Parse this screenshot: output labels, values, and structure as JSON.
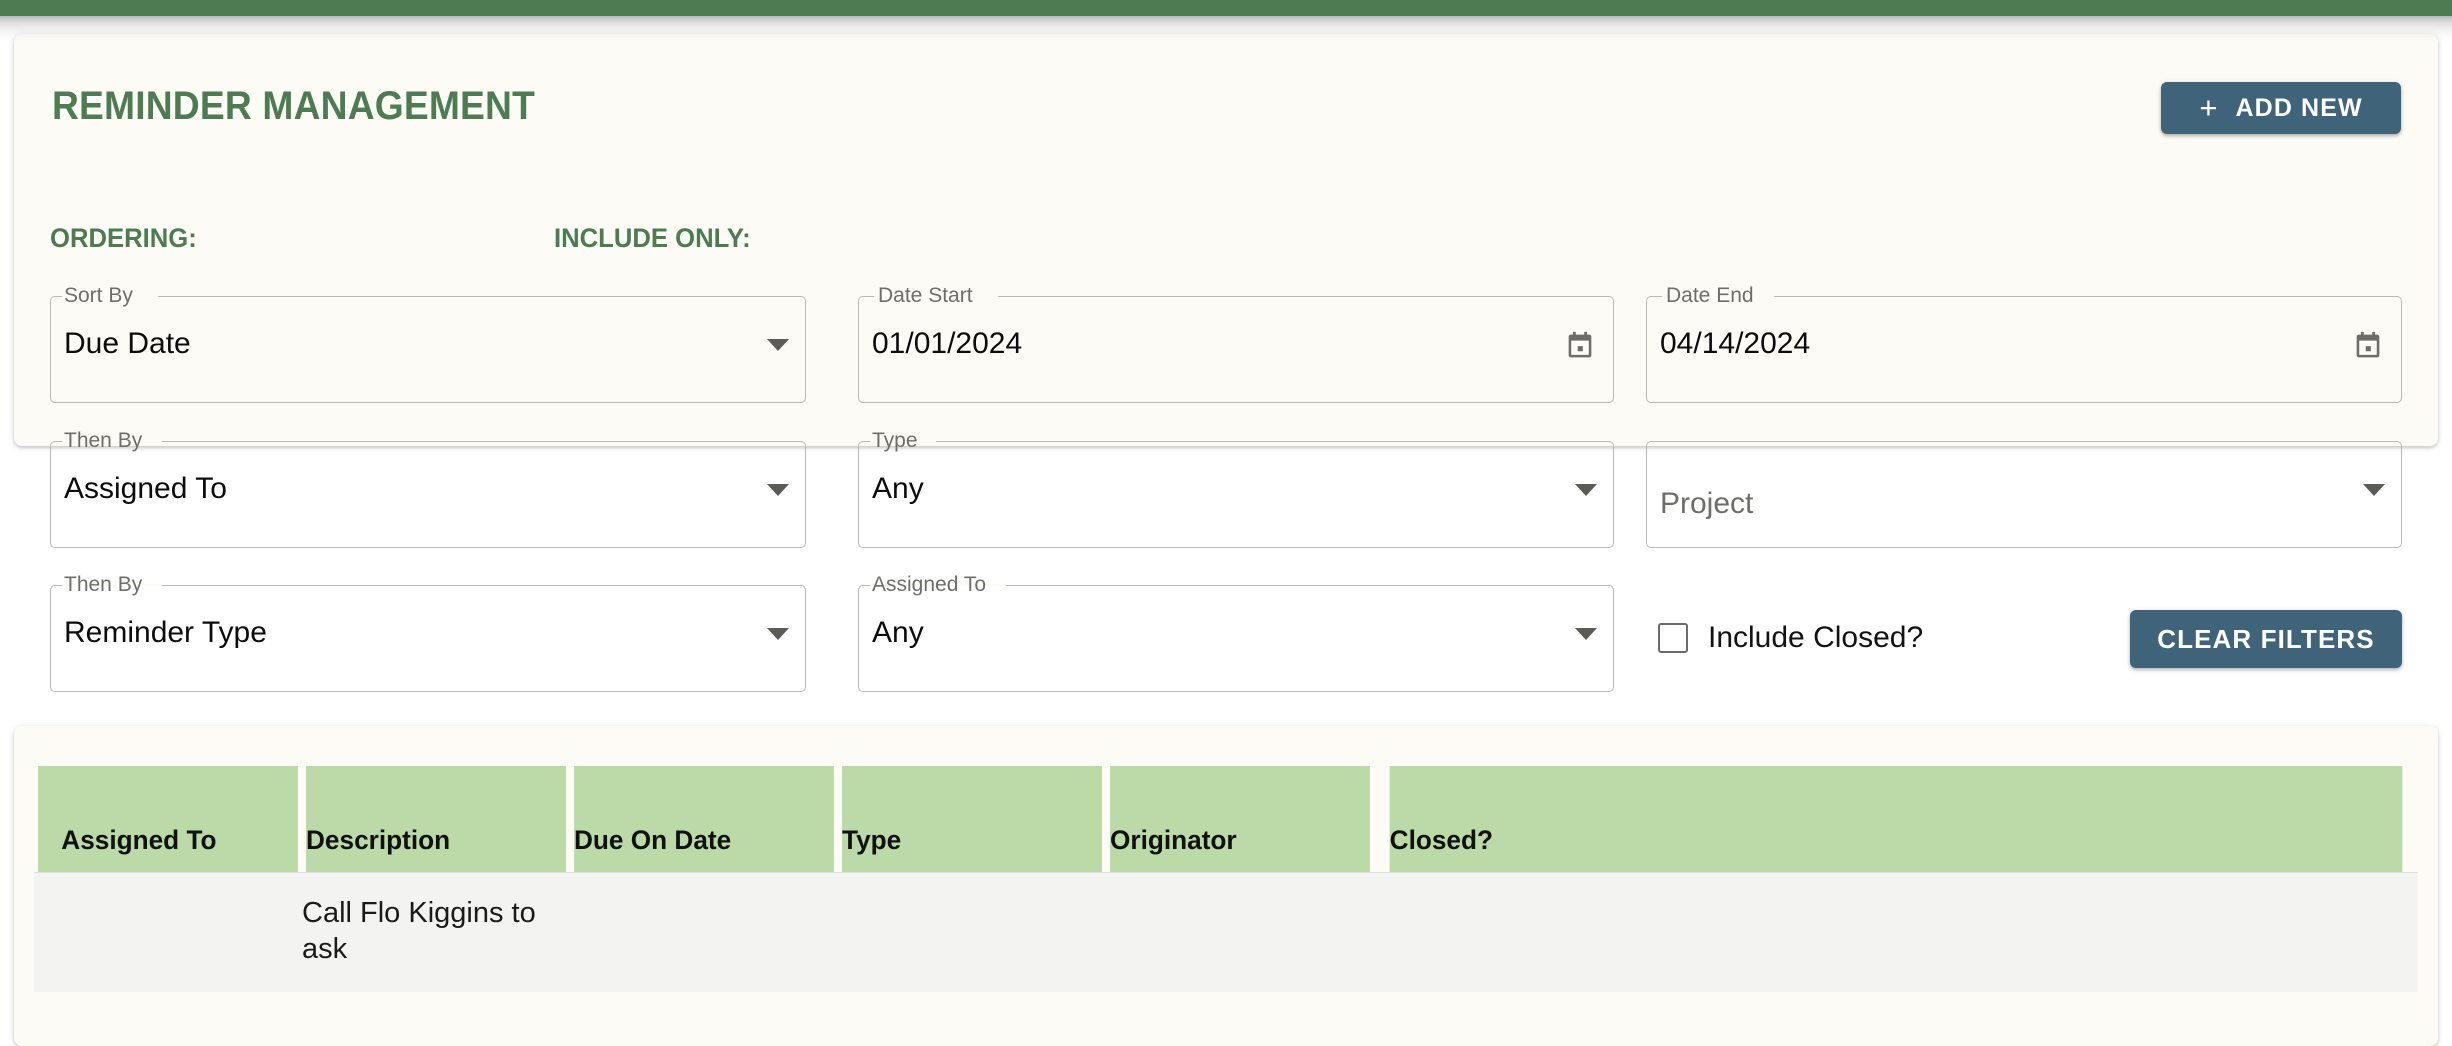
{
  "app_bar": {
    "color": "#4d7b52"
  },
  "theme": {
    "accent_green": "#4d7b52",
    "card_bg": "#fcfbf5",
    "button_blue": "#3f6378",
    "table_header_green": "#bcd9a8",
    "table_row_bg": "#f3f3f2"
  },
  "header": {
    "title": "REMINDER MANAGEMENT",
    "add_new_label": "ADD NEW",
    "add_new_icon": "plus-icon"
  },
  "filters": {
    "ordering_label": "ORDERING:",
    "include_only_label": "INCLUDE ONLY:",
    "sort_by": {
      "label": "Sort By",
      "value": "Due Date",
      "icon": "chevron-down-icon"
    },
    "then_by_1": {
      "label": "Then By",
      "value": "Assigned To",
      "icon": "chevron-down-icon"
    },
    "then_by_2": {
      "label": "Then By",
      "value": "Reminder Type",
      "icon": "chevron-down-icon"
    },
    "date_start": {
      "label": "Date Start",
      "value": "01/01/2024",
      "icon": "calendar-icon"
    },
    "date_end": {
      "label": "Date End",
      "value": "04/14/2024",
      "icon": "calendar-icon"
    },
    "type": {
      "label": "Type",
      "value": "Any",
      "icon": "chevron-down-icon"
    },
    "assigned_to": {
      "label": "Assigned To",
      "value": "Any",
      "icon": "chevron-down-icon"
    },
    "project": {
      "label": "",
      "placeholder": "Project",
      "icon": "chevron-down-icon"
    },
    "include_closed": {
      "label": "Include Closed?",
      "checked": false
    },
    "clear_filters_label": "CLEAR FILTERS"
  },
  "table": {
    "columns": [
      "Assigned To",
      "Description",
      "Due On Date",
      "Type",
      "Originator",
      "Closed?"
    ],
    "rows": [
      {
        "assigned_to": "",
        "description": "Call Flo Kiggins to ask",
        "due_on_date": "",
        "type": "",
        "originator": "",
        "closed": ""
      }
    ]
  }
}
